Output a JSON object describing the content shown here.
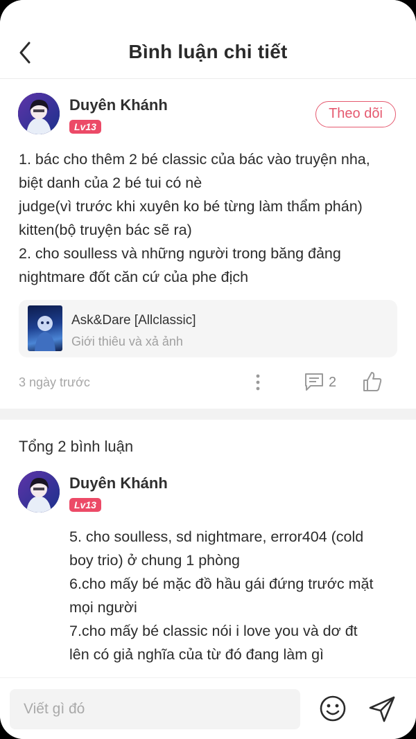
{
  "header": {
    "title": "Bình luận chi tiết"
  },
  "post": {
    "username": "Duyên Khánh",
    "level": "Lv13",
    "follow_label": "Theo dõi",
    "lines": [
      "1. bác cho thêm 2 bé classic của bác vào truyện nha,",
      "biệt danh của 2 bé tui có nè",
      "judge(vì trước khi xuyên ko bé từng làm thẩm phán)",
      "kitten(bộ truyện bác sẽ ra)",
      "2. cho soulless và những người trong băng đảng",
      "nightmare đốt căn cứ của phe địch"
    ],
    "story": {
      "title": "Ask&Dare [Allclassic]",
      "subtitle": "Giới thiêu và xả ảnh"
    },
    "timestamp": "3 ngày trước",
    "comment_count": "2"
  },
  "comments_section": {
    "total_label": "Tổng 2 bình luận",
    "comments": [
      {
        "username": "Duyên Khánh",
        "level": "Lv13",
        "lines": [
          "5. cho soulless, sd nightmare, error404 (cold",
          "boy trio) ở chung 1 phòng",
          "6.cho mấy bé mặc đồ hầu gái đứng trước mặt",
          "mọi người",
          "7.cho mấy bé classic nói i love you và dơ đt",
          "lên có giả nghĩa của từ đó đang làm gì"
        ]
      }
    ]
  },
  "input": {
    "placeholder": "Viết gì đó"
  },
  "icons": {
    "back": "chevron-left-icon",
    "more": "more-vertical-icon",
    "comment": "comment-icon",
    "like": "thumbs-up-icon",
    "emoji": "smiley-icon",
    "send": "send-icon"
  },
  "colors": {
    "accent": "#e5596f",
    "badge": "#ec4a67",
    "muted": "#a6a6a6"
  }
}
